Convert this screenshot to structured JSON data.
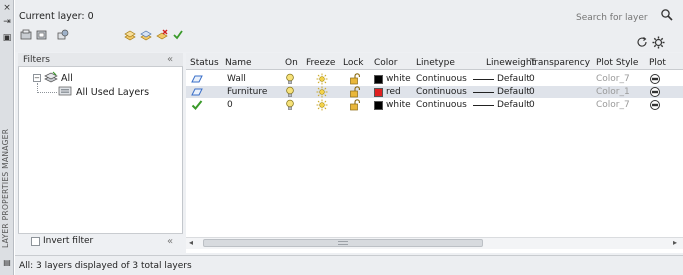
{
  "palette": {
    "title": "LAYER PROPERTIES MANAGER",
    "controls": [
      "×",
      "⇥",
      "▣"
    ]
  },
  "header": {
    "current_layer": "Current layer: 0",
    "search_placeholder": "Search for layer"
  },
  "filters": {
    "title": "Filters",
    "collapse_glyph": "«",
    "tree": {
      "root_label": "All",
      "child_label": "All Used Layers"
    },
    "invert_filter_label": "Invert filter",
    "invert_filter_checked": false
  },
  "grid": {
    "columns": [
      "Status",
      "Name",
      "On",
      "Freeze",
      "Lock",
      "Color",
      "Linetype",
      "Lineweight",
      "Transparency",
      "Plot Style",
      "Plot"
    ],
    "rows": [
      {
        "status_icon": "layer-sheet-icon",
        "name": "Wall",
        "on_icon": "bulb-icon",
        "freeze_icon": "sun-icon",
        "lock_icon": "unlock-icon",
        "color_name": "white",
        "color_hex": "#000000",
        "linetype": "Continuous",
        "lineweight": "Default",
        "transparency": "0",
        "plot_style": "Color_7",
        "plot_icon": "printer-icon"
      },
      {
        "status_icon": "layer-sheet-icon",
        "name": "Furniture",
        "on_icon": "bulb-icon",
        "freeze_icon": "sun-icon",
        "lock_icon": "unlock-icon",
        "color_name": "red",
        "color_hex": "#e02020",
        "linetype": "Continuous",
        "lineweight": "Default",
        "transparency": "0",
        "plot_style": "Color_1",
        "plot_icon": "printer-icon"
      },
      {
        "status_icon": "current-checkmark-icon",
        "name": "0",
        "on_icon": "bulb-icon",
        "freeze_icon": "sun-icon",
        "lock_icon": "unlock-icon",
        "color_name": "white",
        "color_hex": "#000000",
        "linetype": "Continuous",
        "lineweight": "Default",
        "transparency": "0",
        "plot_style": "Color_7",
        "plot_icon": "printer-icon"
      }
    ],
    "selected_row": 1
  },
  "scrollbar": {
    "left_glyph": "◂",
    "right_glyph": "▸"
  },
  "status_bar": {
    "text": "All: 3 layers displayed of 3 total layers"
  },
  "colors": {
    "accent_blue": "#3a6fc8",
    "current_green": "#3a9a2a",
    "bulb_yellow": "#e8c020",
    "lock_gold": "#d09a20",
    "selection_row": "#dfe3ea"
  }
}
